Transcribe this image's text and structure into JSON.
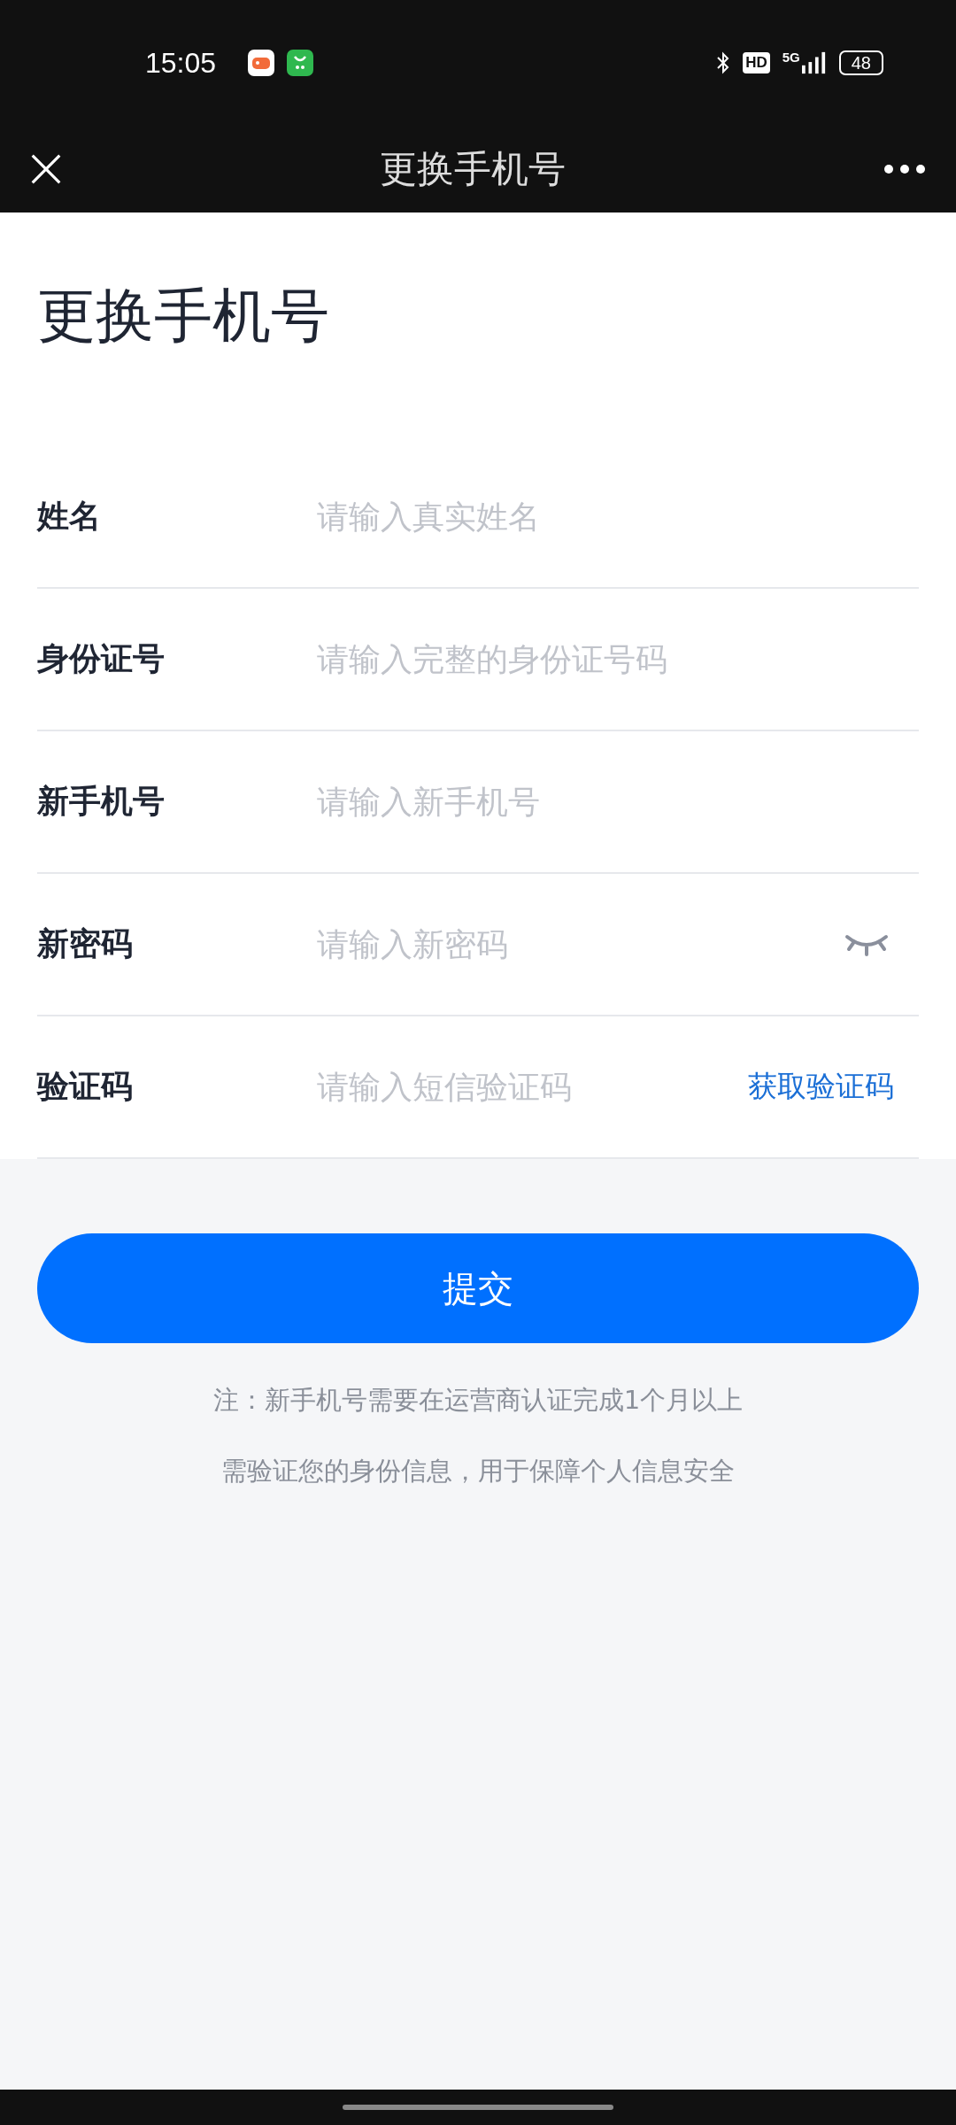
{
  "status_bar": {
    "time": "15:05",
    "network": "5G",
    "hd": "HD",
    "battery": "48"
  },
  "nav_bar": {
    "title": "更换手机号"
  },
  "page_title": "更换手机号",
  "fields": [
    {
      "kind": "text",
      "label": "姓名",
      "placeholder": "请输入真实姓名"
    },
    {
      "kind": "text",
      "label": "身份证号",
      "placeholder": "请输入完整的身份证号码"
    },
    {
      "kind": "text",
      "label": "新手机号",
      "placeholder": "请输入新手机号"
    },
    {
      "kind": "password",
      "label": "新密码",
      "placeholder": "请输入新密码"
    },
    {
      "kind": "code",
      "label": "验证码",
      "placeholder": "请输入短信验证码",
      "action": "获取验证码"
    }
  ],
  "submit_button": "提交",
  "notes": [
    "注：新手机号需要在运营商认证完成1个月以上",
    "需验证您的身份信息，用于保障个人信息安全"
  ]
}
